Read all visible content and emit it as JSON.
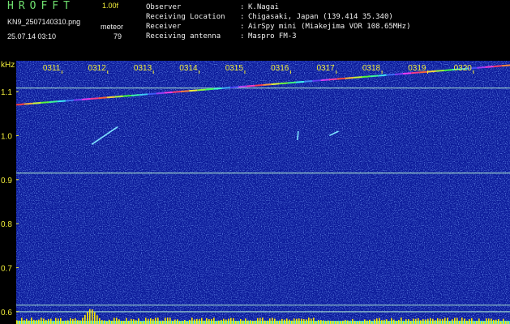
{
  "header": {
    "app_title": "HROFFT",
    "app_version": "1.00f",
    "file_name": "KN9_2507140310.png",
    "meteor_label": "meteor",
    "timestamp": "25.07.14 03:10",
    "meteor_count": "79",
    "info": [
      {
        "key": "Observer",
        "value": "K.Nagai"
      },
      {
        "key": "Receiving Location",
        "value": "Chigasaki, Japan (139.414 35.340)"
      },
      {
        "key": "Receiver",
        "value": "AirSpy mini (Miakejima VOR 108.65MHz)"
      },
      {
        "key": "Receiving antenna",
        "value": "Maspro FM-3"
      }
    ]
  },
  "colors": {
    "background": "#000000",
    "plot_background": "#0b1a9a",
    "label_yellow": "#f2ee3a",
    "header_green": "#6fe06f",
    "trace_line": "#aee8d0",
    "spectrum_bar": "#ffe800",
    "baseline": "#3fd6e8"
  },
  "chart_data": {
    "type": "heatmap",
    "yunit": "kHz",
    "y_ticks": [
      "1.1",
      "1.0",
      "0.9",
      "0.8",
      "0.7",
      "0.6"
    ],
    "x_ticks": [
      "0311",
      "0312",
      "0313",
      "0314",
      "0315",
      "0316",
      "0317",
      "0318",
      "0319",
      "0320"
    ],
    "x_range": [
      3.1,
      3.208
    ],
    "y_range": [
      0.585,
      1.17
    ],
    "horizontal_lines_khz": [
      1.108,
      0.915,
      0.615,
      0.6
    ],
    "doppler_trace": {
      "start": [
        3.1,
        1.07
      ],
      "end": [
        3.208,
        1.16
      ]
    },
    "meteor_echoes": [
      {
        "x0": 3.1165,
        "y0": 0.98,
        "x1": 3.1222,
        "y1": 1.02
      },
      {
        "x0": 3.1615,
        "y0": 0.99,
        "x1": 3.1617,
        "y1": 1.01
      },
      {
        "x0": 3.1685,
        "y0": 1.0,
        "x1": 3.1705,
        "y1": 1.01
      }
    ],
    "spectrum_peak_x": 3.1162
  }
}
